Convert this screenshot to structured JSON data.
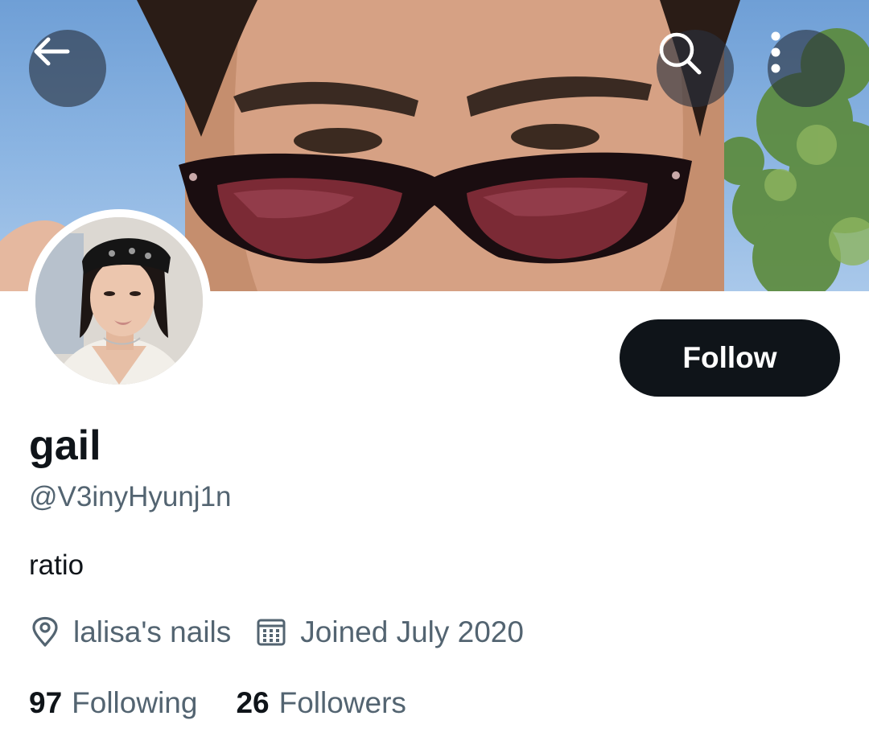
{
  "header": {
    "back_icon": "arrow-left-icon",
    "search_icon": "search-icon",
    "more_icon": "more-vertical-icon"
  },
  "profile": {
    "display_name": "gail",
    "handle": "@V3inyHyunj1n",
    "bio": "ratio",
    "location": "lalisa's nails",
    "joined": "Joined July 2020",
    "follow_label": "Follow",
    "following_count": "97",
    "following_label": "Following",
    "followers_count": "26",
    "followers_label": "Followers"
  },
  "colors": {
    "primary_text": "#0f1419",
    "secondary_text": "#536471",
    "follow_button_bg": "#0f1419",
    "follow_button_text": "#ffffff"
  }
}
